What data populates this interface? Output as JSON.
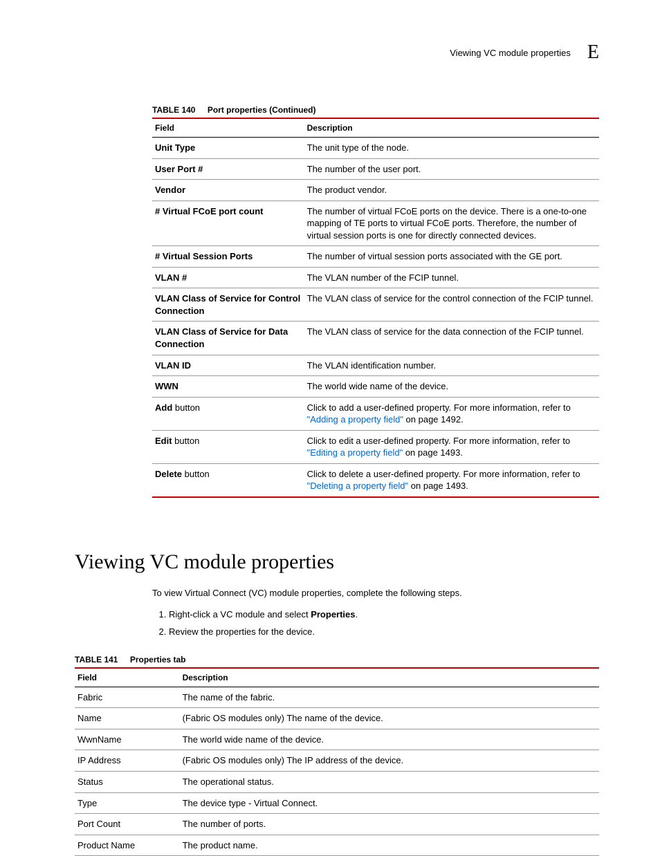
{
  "header": {
    "running_title": "Viewing VC module properties",
    "appendix": "E"
  },
  "table140": {
    "label": "TABLE 140",
    "title": "Port properties (Continued)",
    "head_field": "Field",
    "head_desc": "Description",
    "rows": [
      {
        "field_bold": "Unit Type",
        "field_rest": "",
        "desc": "The unit type of the node.",
        "link_text": "",
        "link_tail": ""
      },
      {
        "field_bold": "User Port #",
        "field_rest": "",
        "desc": "The number of the user port.",
        "link_text": "",
        "link_tail": ""
      },
      {
        "field_bold": "Vendor",
        "field_rest": "",
        "desc": "The product vendor.",
        "link_text": "",
        "link_tail": ""
      },
      {
        "field_bold": "# Virtual FCoE port count",
        "field_rest": "",
        "desc": "The number of virtual FCoE ports on the device. There is a one-to-one mapping of TE ports to virtual FCoE ports. Therefore, the number of virtual session ports is one for directly connected devices.",
        "link_text": "",
        "link_tail": ""
      },
      {
        "field_bold": "# Virtual Session Ports",
        "field_rest": "",
        "desc": "The number of virtual session ports associated with the GE port.",
        "link_text": "",
        "link_tail": ""
      },
      {
        "field_bold": "VLAN #",
        "field_rest": "",
        "desc": "The VLAN number of the FCIP tunnel.",
        "link_text": "",
        "link_tail": ""
      },
      {
        "field_bold": "VLAN Class of Service for Control Connection",
        "field_rest": "",
        "desc": "The VLAN class of service for the control connection of the FCIP tunnel.",
        "link_text": "",
        "link_tail": ""
      },
      {
        "field_bold": "VLAN Class of Service for Data Connection",
        "field_rest": "",
        "desc": "The VLAN class of service for the data connection of the FCIP tunnel.",
        "link_text": "",
        "link_tail": ""
      },
      {
        "field_bold": "VLAN ID",
        "field_rest": "",
        "desc": "The VLAN identification number.",
        "link_text": "",
        "link_tail": ""
      },
      {
        "field_bold": "WWN",
        "field_rest": "",
        "desc": "The world wide name of the device.",
        "link_text": "",
        "link_tail": ""
      },
      {
        "field_bold": "Add",
        "field_rest": " button",
        "desc": "Click to add a user-defined property. For more information, refer to ",
        "link_text": "\"Adding a property field\"",
        "link_tail": " on page 1492."
      },
      {
        "field_bold": "Edit",
        "field_rest": " button",
        "desc": "Click to edit a user-defined property. For more information, refer to ",
        "link_text": "\"Editing a property field\"",
        "link_tail": " on page 1493."
      },
      {
        "field_bold": "Delete",
        "field_rest": " button",
        "desc": "Click to delete a user-defined property. For more information, refer to ",
        "link_text": "\"Deleting a property field\"",
        "link_tail": " on page 1493."
      }
    ]
  },
  "section": {
    "title": "Viewing VC module properties",
    "intro": "To view Virtual Connect (VC) module properties, complete the following steps.",
    "step1_pre": "Right-click a VC module and select ",
    "step1_bold": "Properties",
    "step1_post": ".",
    "step2": "Review the properties for the device."
  },
  "table141": {
    "label": "TABLE 141",
    "title": "Properties tab",
    "head_field": "Field",
    "head_desc": "Description",
    "rows": [
      {
        "field": "Fabric",
        "desc": "The name of the fabric."
      },
      {
        "field": "Name",
        "desc": "(Fabric OS modules only) The name of the device."
      },
      {
        "field": "WwnName",
        "desc": "The world wide name of the device."
      },
      {
        "field": "IP Address",
        "desc": "(Fabric OS modules only) The IP address of the device."
      },
      {
        "field": "Status",
        "desc": "The operational status."
      },
      {
        "field": "Type",
        "desc": "The device type - Virtual Connect."
      },
      {
        "field": "Port Count",
        "desc": "The number of ports."
      },
      {
        "field": "Product Name",
        "desc": "The product name."
      }
    ]
  }
}
